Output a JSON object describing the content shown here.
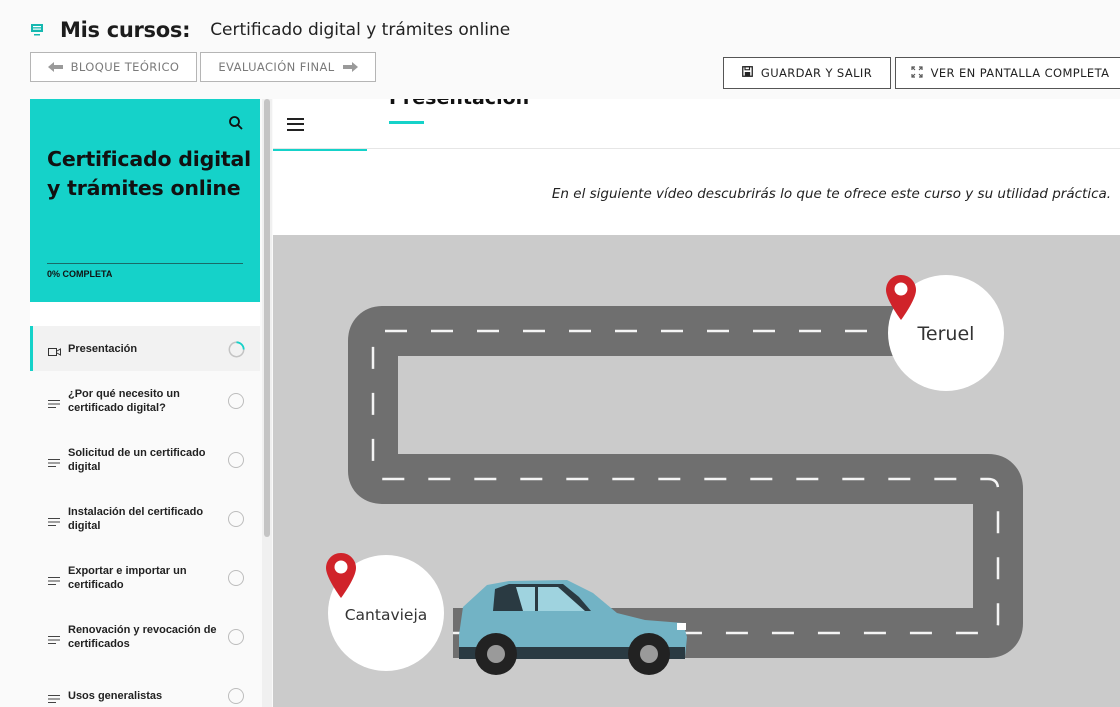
{
  "header": {
    "section_label": "Mis cursos:",
    "course_title": "Certificado digital y trámites online",
    "prev_button": "BLOQUE TEÓRICO",
    "next_button": "EVALUACIÓN FINAL",
    "save_button": "GUARDAR Y SALIR",
    "fullscreen_button": "VER EN PANTALLA COMPLETA"
  },
  "sidebar": {
    "title": "Certificado digital y trámites online",
    "progress_label": "0% COMPLETA",
    "progress_fraction": 0,
    "accent_color": "#15d2c9",
    "lessons": [
      {
        "label": "Presentación",
        "icon": "video-icon",
        "active": true,
        "status": "in-progress"
      },
      {
        "label": "¿Por qué necesito un certificado digital?",
        "icon": "text-lines-icon",
        "active": false,
        "status": "not-started"
      },
      {
        "label": "Solicitud de un certificado digital",
        "icon": "text-lines-icon",
        "active": false,
        "status": "not-started"
      },
      {
        "label": "Instalación del certificado digital",
        "icon": "text-lines-icon",
        "active": false,
        "status": "not-started"
      },
      {
        "label": "Exportar e importar un certificado",
        "icon": "text-lines-icon",
        "active": false,
        "status": "not-started"
      },
      {
        "label": "Renovación y revocación de certificados",
        "icon": "text-lines-icon",
        "active": false,
        "status": "not-started"
      },
      {
        "label": "Usos generalistas",
        "icon": "text-lines-icon",
        "active": false,
        "status": "not-started"
      }
    ]
  },
  "main": {
    "lesson_heading": "Presentación",
    "intro_text": "En el siguiente vídeo descubrirás lo que te ofrece este curso y su utilidad práctica.",
    "video": {
      "destination_label": "Teruel",
      "origin_label": "Cantavieja",
      "road_color": "#6f6f6f",
      "pin_color": "#d0232a",
      "car_color": "#72b3c5"
    }
  }
}
